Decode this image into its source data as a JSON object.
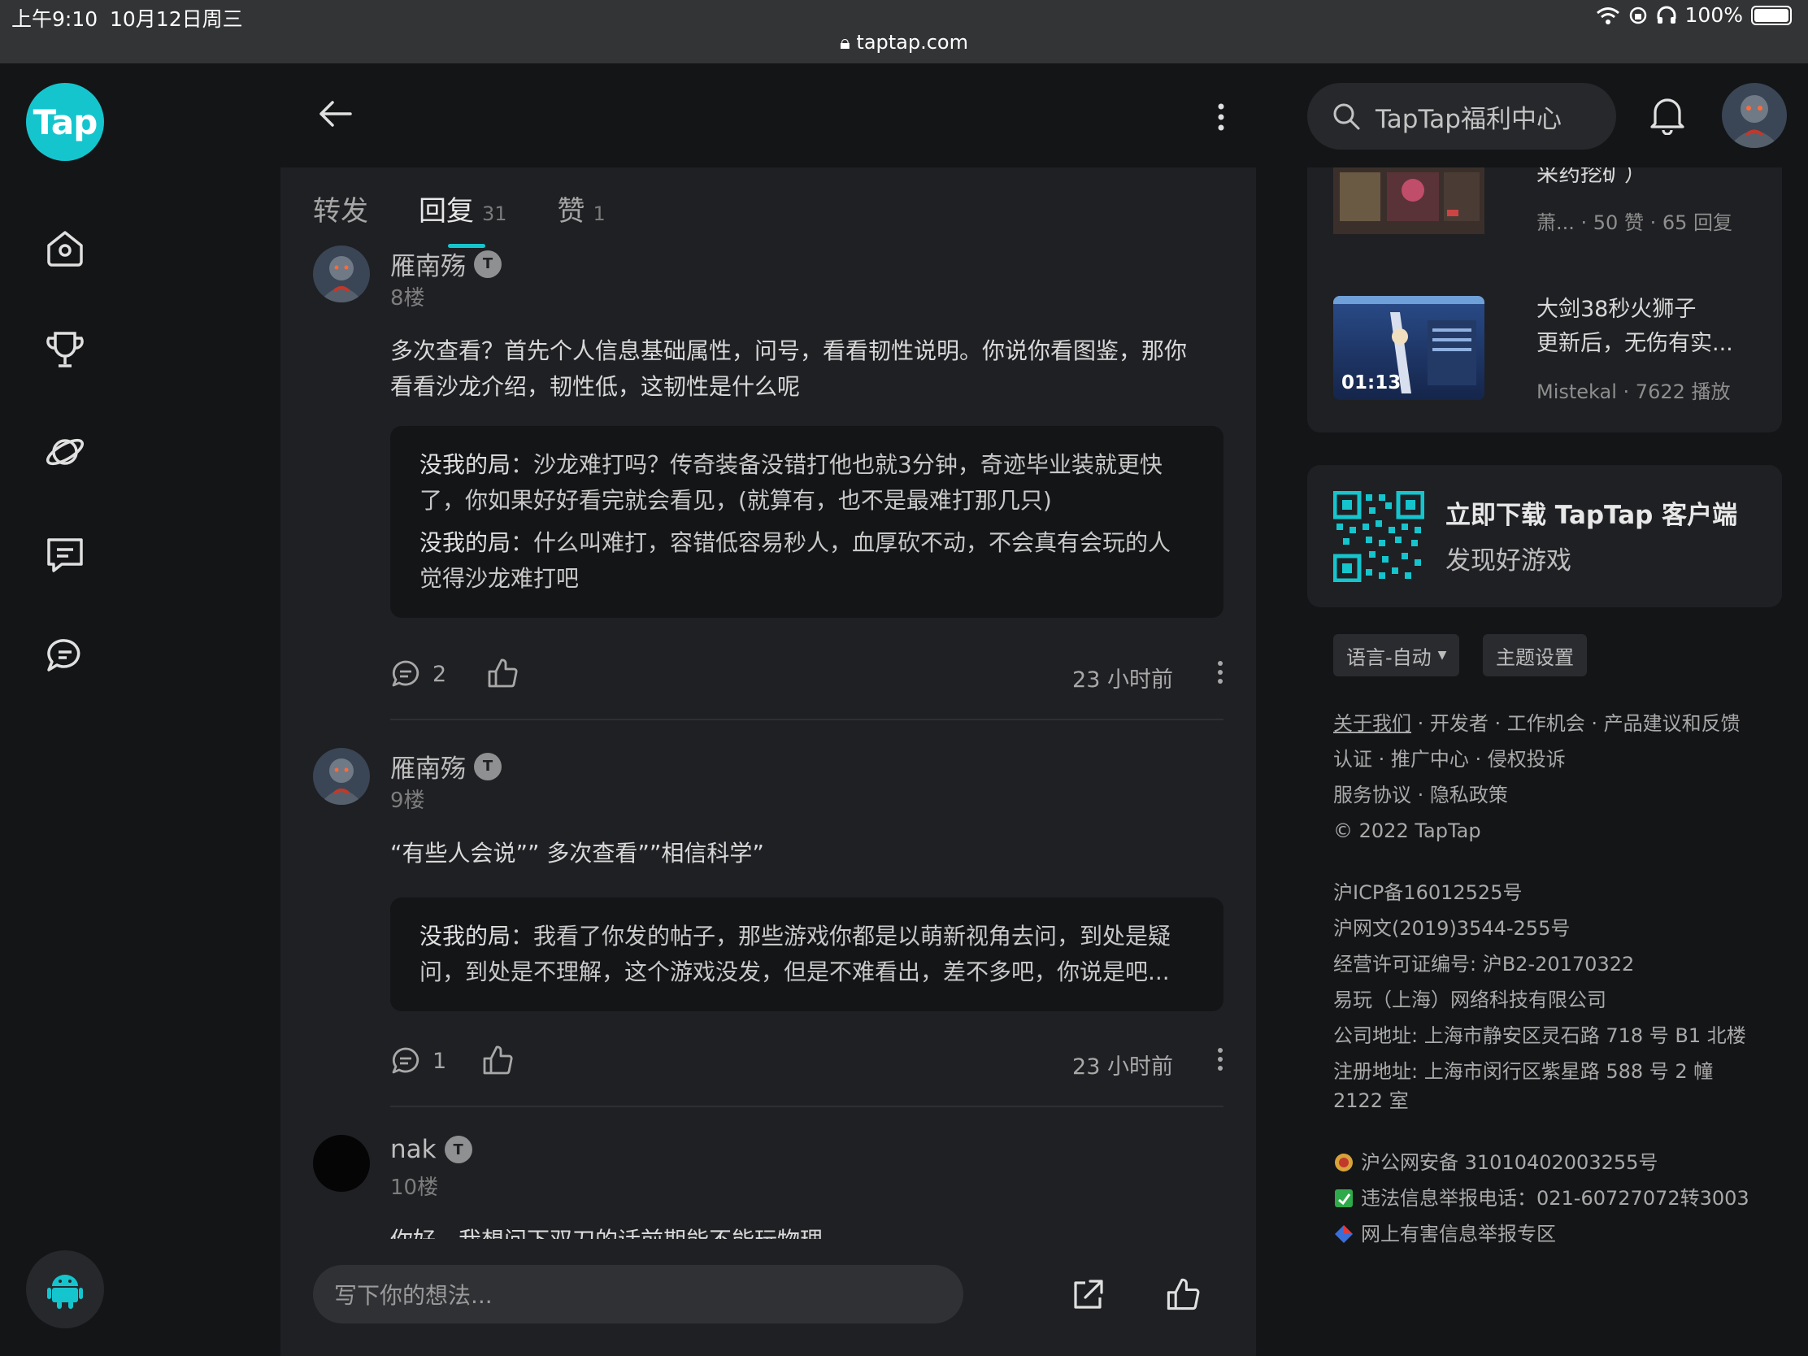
{
  "status_bar": {
    "time": "上午9:10",
    "date": "10月12日周三",
    "battery": "100%",
    "url": "taptap.com"
  },
  "brand": {
    "logo_text": "Tap",
    "accent_color": "#15c5ce"
  },
  "rail": {
    "icons": [
      "home-icon",
      "trophy-icon",
      "planet-icon",
      "chat-card-icon",
      "chat-bubbles-icon"
    ],
    "bottom_icon": "android-icon"
  },
  "tabs": [
    {
      "label": "转发",
      "count": ""
    },
    {
      "label": "回复",
      "count": "31"
    },
    {
      "label": "赞",
      "count": "1"
    }
  ],
  "comments": [
    {
      "author": "雁南殇",
      "badge": "T",
      "floor": "8楼",
      "text_lines": [
        "多次查看？首先个人信息基础属性，问号，看看韧性说明。你说你看图鉴，那你",
        "看看沙龙介绍，韧性低，这韧性是什么呢"
      ],
      "replies": [
        {
          "author": "没我的局",
          "lines": [
            "：沙龙难打吗？传奇装备没错打他也就3分钟，奇迹毕业装就更快",
            "了，你如果好好看完就会看见，(就算有，也不是最难打那几只)"
          ]
        },
        {
          "author": "没我的局",
          "lines": [
            "：什么叫难打，容错低容易秒人，血厚砍不动，不会真有会玩的人",
            "觉得沙龙难打吧"
          ]
        }
      ],
      "reply_count": "2",
      "time": "23 小时前"
    },
    {
      "author": "雁南殇",
      "badge": "T",
      "floor": "9楼",
      "text_lines": [
        "“有些人会说”” 多次查看””相信科学”"
      ],
      "replies": [
        {
          "author": "没我的局",
          "lines": [
            "：我看了你发的帖子，那些游戏你都是以萌新视角去问，到处是疑",
            "问，到处是不理解，这个游戏没发，但是不难看出，差不多吧，你说是吧..."
          ]
        }
      ],
      "reply_count": "1",
      "time": "23 小时前"
    },
    {
      "author": "nak",
      "badge": "T",
      "floor": "10楼",
      "text_lines": [
        "你好，我想问下双刀的话前期能不能玩物理"
      ]
    }
  ],
  "composer": {
    "placeholder": "写下你的想法..."
  },
  "search": {
    "placeholder": "TapTap福利中心"
  },
  "recommendations": [
    {
      "title_lines": [
        "采药挖矿）"
      ],
      "meta": "萧...   · 50 赞 · 65 回复"
    },
    {
      "title_lines": [
        "大剑38秒火狮子",
        "更新后，无伤有实..."
      ],
      "meta": "Mistekal · 7622 播放",
      "duration": "01:13"
    }
  ],
  "download": {
    "title": "立即下载 TapTap 客户端",
    "subtitle": "发现好游戏"
  },
  "settings": {
    "language": "语言-自动",
    "theme": "主题设置"
  },
  "footer": {
    "links_row1": [
      "关于我们",
      "开发者",
      "工作机会",
      "产品建议和反馈"
    ],
    "links_row2": [
      "认证",
      "推广中心",
      "侵权投诉"
    ],
    "links_row3": [
      "服务协议",
      "隐私政策"
    ],
    "copyright": "© 2022 TapTap",
    "icp": "沪ICP备16012525号",
    "netculture": "沪网文(2019)3544-255号",
    "license": "经营许可证编号: 沪B2-20170322",
    "company": "易玩（上海）网络科技有限公司",
    "address": "公司地址: 上海市静安区灵石路 718 号 B1 北楼",
    "reg_address_1": "注册地址: 上海市闵行区紫星路 588 号 2 幢",
    "reg_address_2": "2122 室",
    "police": "沪公网安备 31010402003255号",
    "report_phone": "违法信息举报电话：021-60727072转3003",
    "harmful": "网上有害信息举报专区"
  }
}
